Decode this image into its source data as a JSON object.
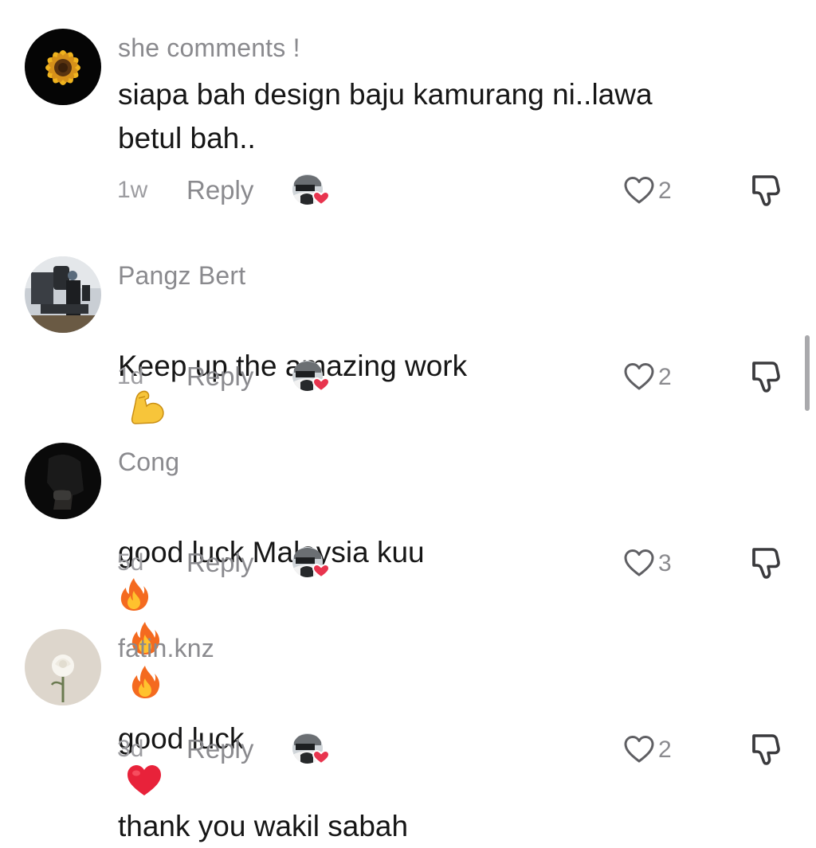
{
  "reply_label": "Reply",
  "comments": [
    {
      "username": "she comments !",
      "text": "siapa bah design baju kamurang ni..lawa\nbetul bah..",
      "time": "1w",
      "likes": "2",
      "avatar_icon": "sunflower"
    },
    {
      "username": "Pangz Bert",
      "text": "Keep up the amazing work",
      "emoji": "flexed-biceps",
      "time": "1d",
      "likes": "2",
      "avatar_icon": "microscope"
    },
    {
      "username": "Cong",
      "text": "good luck Malaysia kuu",
      "emoji": "fire x3",
      "time": "5d",
      "likes": "3",
      "avatar_icon": "dark-portrait"
    },
    {
      "username": "fatin.knz",
      "text_before": "good luck",
      "text_after": "thank you wakil sabah",
      "emoji": "red-heart",
      "time": "3d",
      "likes": "2",
      "avatar_icon": "white-rose"
    }
  ],
  "colors": {
    "username": "#8a8a8e",
    "text": "#161616",
    "meta": "#9d9da1",
    "heart": "#e8344e"
  }
}
